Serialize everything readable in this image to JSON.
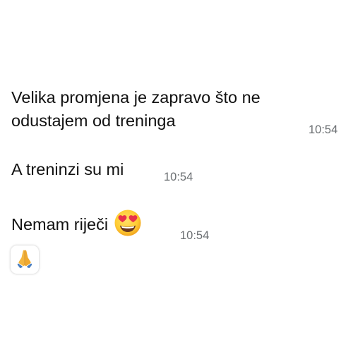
{
  "messages": [
    {
      "line1": "Velika promjena je zapravo što ne",
      "line2": "odustajem od treninga",
      "time": "10:54"
    },
    {
      "text": "A treninzi su mi",
      "time": "10:54"
    },
    {
      "text": "Nemam riječi",
      "emoji": "heart-eyes-face",
      "time": "10:54",
      "reaction": "folded-hands"
    }
  ],
  "colors": {
    "text": "#111111",
    "timestamp": "#6b6f72",
    "emoji_yellow": "#FFCC33",
    "heart_red": "#E8324A"
  }
}
